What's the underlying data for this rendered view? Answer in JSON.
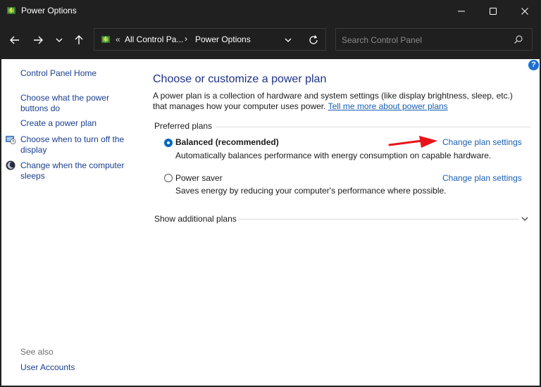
{
  "window": {
    "title": "Power Options"
  },
  "address": {
    "overflow": "«",
    "crumb1": "All Control Pa...",
    "separator": "›",
    "crumb2": "Power Options"
  },
  "search": {
    "placeholder": "Search Control Panel"
  },
  "sidebar": {
    "home": "Control Panel Home",
    "items": [
      {
        "label": "Choose what the power buttons do"
      },
      {
        "label": "Create a power plan"
      },
      {
        "label": "Choose when to turn off the display"
      },
      {
        "label": "Change when the computer sleeps"
      }
    ],
    "see_also": "See also",
    "user_accounts": "User Accounts"
  },
  "main": {
    "title": "Choose or customize a power plan",
    "description": "A power plan is a collection of hardware and system settings (like display brightness, sleep, etc.) that manages how your computer uses power.",
    "learn_more": "Tell me more about power plans",
    "preferred_plans": "Preferred plans",
    "plans": [
      {
        "name": "Balanced (recommended)",
        "description": "Automatically balances performance with energy consumption on capable hardware.",
        "link": "Change plan settings",
        "selected": true
      },
      {
        "name": "Power saver",
        "description": "Saves energy by reducing your computer's performance where possible.",
        "link": "Change plan settings",
        "selected": false
      }
    ],
    "show_additional": "Show additional plans",
    "help": "?"
  },
  "colors": {
    "accent": "#0067c0",
    "link": "#1a5fb4",
    "title_blue": "#1e3287",
    "annotation_arrow": "#e8141b"
  }
}
